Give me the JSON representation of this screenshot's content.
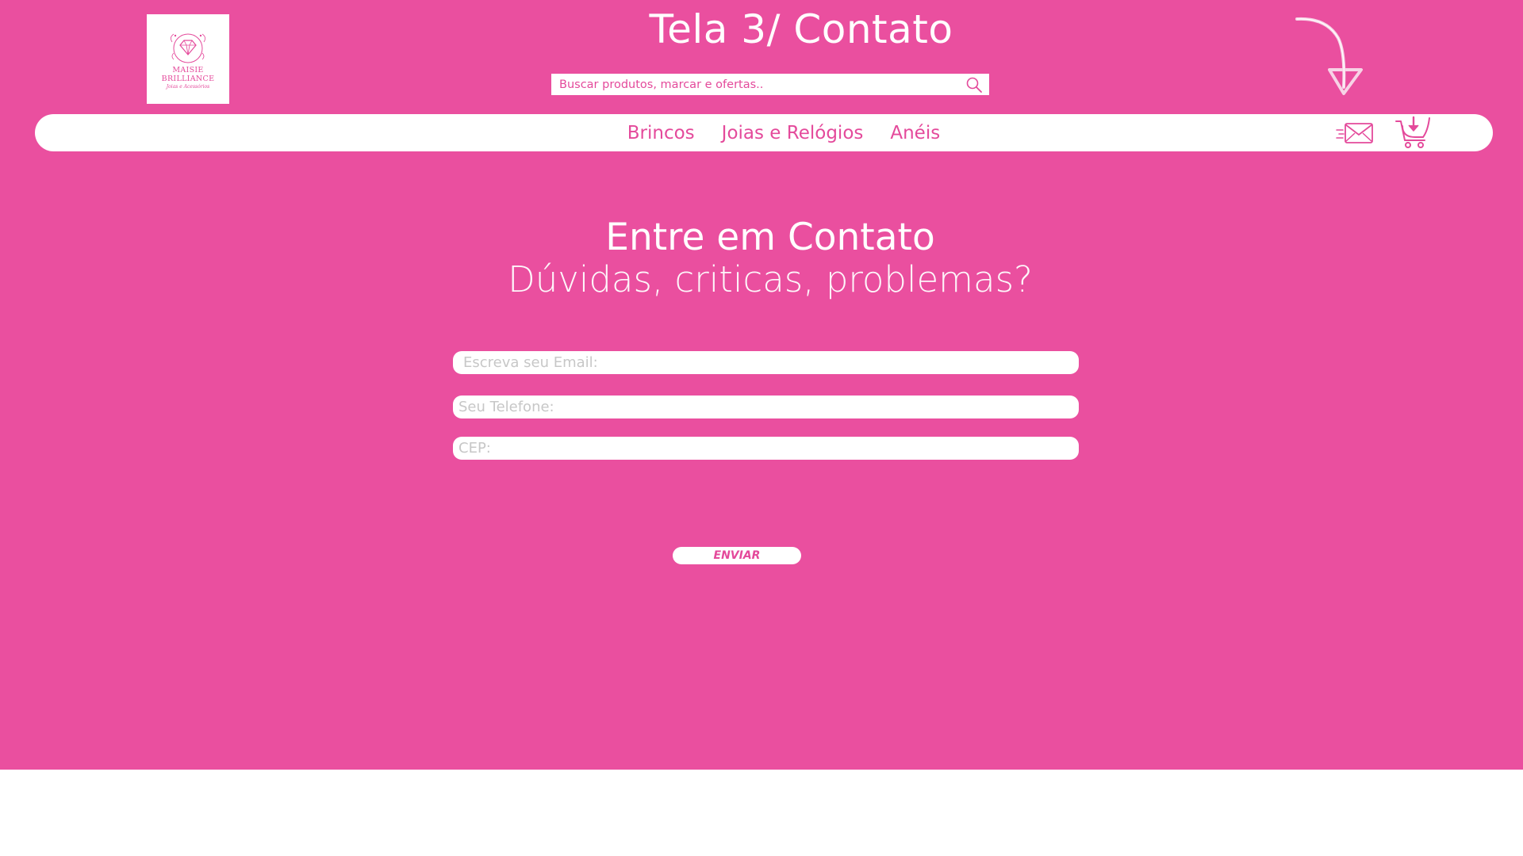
{
  "header": {
    "screen_title": "Tela 3/ Contato",
    "logo": {
      "name_line1": "MAISIE",
      "name_line2": "BRILLIANCE",
      "tagline": "Joias e Acessórios"
    },
    "search": {
      "placeholder": "Buscar produtos, marcar e ofertas.."
    }
  },
  "nav": {
    "links": [
      {
        "label": "Brincos"
      },
      {
        "label": "Joias e Relógios"
      },
      {
        "label": "Anéis"
      }
    ]
  },
  "contact": {
    "heading": "Entre em Contato",
    "subheading": "Dúvidas, criticas, problemas?",
    "fields": {
      "email_placeholder": "Escreva seu Email:",
      "phone_placeholder": "Seu Telefone:",
      "cep_placeholder": "CEP:"
    },
    "send_label": "ENVIAR"
  },
  "colors": {
    "brand_pink": "#ea4f9f",
    "accent_pink": "#e44a9b",
    "white": "#ffffff"
  },
  "icons": [
    "diamond-logo-icon",
    "search-icon",
    "arrow-down-icon",
    "mail-icon",
    "cart-icon"
  ]
}
